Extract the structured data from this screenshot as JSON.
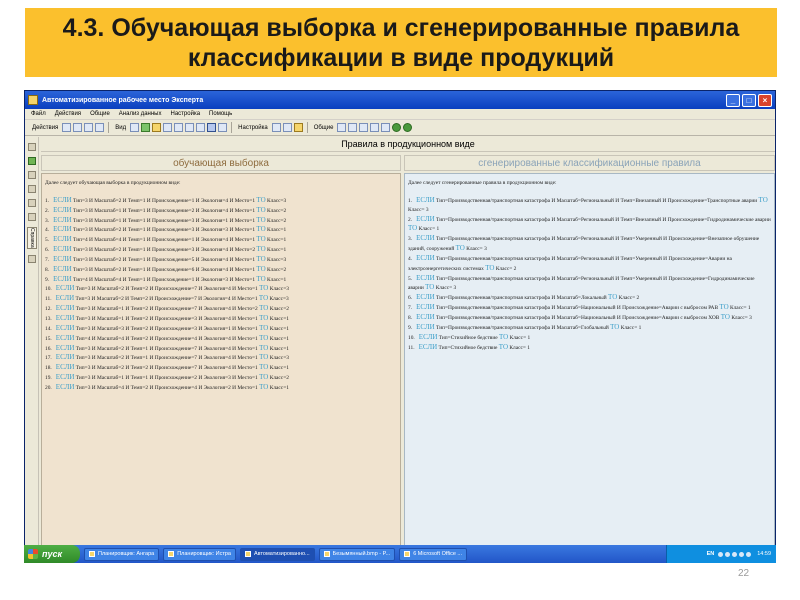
{
  "slide": {
    "title_line1": "4.3. Обучающая выборка и сгенерированные правила",
    "title_line2": "классификации в виде продукций",
    "page_number": "22"
  },
  "window": {
    "title": "Автоматизированное рабочее место Эксперта",
    "menu": [
      "Файл",
      "Действия",
      "Общие",
      "Анализ данных",
      "Настройка",
      "Помощь"
    ],
    "toolbar": {
      "actions_label": "Действия",
      "view_label": "Вид",
      "settings_label": "Настройка",
      "common_label": "Общие"
    },
    "left_tab_label": "Справка",
    "pane_header": "Правила в продукционном виде"
  },
  "left_panel": {
    "title": "обучающая выборка",
    "intro": "Далее следует обучающая выборка в продукционном виде:",
    "if": "ЕСЛИ",
    "then": "ТО",
    "rows": [
      {
        "n": "1.",
        "cond": "Тип=3 И Масштаб=2 И Темп=1 И Происхождение=1 И Экология=4 И Место=1",
        "cls": "Класс=3"
      },
      {
        "n": "2.",
        "cond": "Тип=3 И Масштаб=1 И Темп=1 И Происхождение=2 И Экология=4 И Место=1",
        "cls": "Класс=2"
      },
      {
        "n": "3.",
        "cond": "Тип=3 И Масштаб=1 И Темп=1 И Происхождение=3 И Экология=1 И Место=1",
        "cls": "Класс=2"
      },
      {
        "n": "4.",
        "cond": "Тип=3 И Масштаб=2 И Темп=1 И Происхождение=3 И Экология=3 И Место=1",
        "cls": "Класс=1"
      },
      {
        "n": "5.",
        "cond": "Тип=4 И Масштаб=4 И Темп=1 И Происхождение=1 И Экология=4 И Место=1",
        "cls": "Класс=1"
      },
      {
        "n": "6.",
        "cond": "Тип=3 И Масштаб=2 И Темп=1 И Происхождение=3 И Экология=4 И Место=2",
        "cls": "Класс=1"
      },
      {
        "n": "7.",
        "cond": "Тип=3 И Масштаб=2 И Темп=1 И Происхождение=5 И Экология=4 И Место=1",
        "cls": "Класс=3"
      },
      {
        "n": "8.",
        "cond": "Тип=3 И Масштаб=2 И Темп=1 И Происхождение=6 И Экология=4 И Место=1",
        "cls": "Класс=2"
      },
      {
        "n": "9.",
        "cond": "Тип=4 И Масштаб=4 И Темп=1 И Происхождение=1 И Экология=3 И Место=1",
        "cls": "Класс=1"
      },
      {
        "n": "10.",
        "cond": "Тип=3 И Масштаб=2 И Темп=2 И Происхождение=7 И Экология=4 И Место=1",
        "cls": "Класс=3"
      },
      {
        "n": "11.",
        "cond": "Тип=3 И Масштаб=2 И Темп=2 И Происхождение=7 И Экология=4 И Место=1",
        "cls": "Класс=3"
      },
      {
        "n": "12.",
        "cond": "Тип=3 И Масштаб=1 И Темп=2 И Происхождение=7 И Экология=4 И Место=2",
        "cls": "Класс=2"
      },
      {
        "n": "13.",
        "cond": "Тип=3 И Масштаб=1 И Темп=2 И Происхождение=3 И Экология=4 И Место=1",
        "cls": "Класс=1"
      },
      {
        "n": "14.",
        "cond": "Тип=3 И Масштаб=3 И Темп=2 И Происхождение=3 И Экология=1 И Место=1",
        "cls": "Класс=1"
      },
      {
        "n": "15.",
        "cond": "Тип=4 И Масштаб=4 И Темп=2 И Происхождение=4 И Экология=4 И Место=1",
        "cls": "Класс=1"
      },
      {
        "n": "16.",
        "cond": "Тип=3 И Масштаб=2 И Темп=1 И Происхождение=7 И Экология=4 И Место=1",
        "cls": "Класс=1"
      },
      {
        "n": "17.",
        "cond": "Тип=3 И Масштаб=2 И Темп=1 И Происхождение=7 И Экология=4 И Место=1",
        "cls": "Класс=3"
      },
      {
        "n": "18.",
        "cond": "Тип=3 И Масштаб=2 И Темп=2 И Происхождение=7 И Экология=4 И Место=1",
        "cls": "Класс=1"
      },
      {
        "n": "19.",
        "cond": "Тип=3 И Масштаб=1 И Темп=1 И Происхождение=2 И Экология=3 И Место=1",
        "cls": "Класс=2"
      },
      {
        "n": "20.",
        "cond": "Тип=3 И Масштаб=4 И Темп=2 И Происхождение=4 И Экология=2 И Место=1",
        "cls": "Класс=1"
      }
    ]
  },
  "right_panel": {
    "title": "сгенерированные классификационные правила",
    "intro": "Далее следует сгенерированные правила в продукционном виде:",
    "if": "ЕСЛИ",
    "then": "ТО",
    "rows": [
      {
        "n": "1.",
        "cond": "Тип=Производственная/транспортная катастрофа И Масштаб=Региональный И Темп=Внезапный И Происхождение=Транспортные аварии",
        "cls": "Класс= 3"
      },
      {
        "n": "2.",
        "cond": "Тип=Производственная/транспортная катастрофа И Масштаб=Региональный И Темп=Внезапный И Происхождение=Гидродинамические аварии",
        "cls": "Класс= 1"
      },
      {
        "n": "3.",
        "cond": "Тип=Производственная/транспортная катастрофа И Масштаб=Региональный И Темп=Умеренный И Происхождение=Внезапное обрушение зданий, сооружений",
        "cls": "Класс= 3"
      },
      {
        "n": "4.",
        "cond": "Тип=Производственная/транспортная катастрофа И Масштаб=Региональный И Темп=Умеренный И Происхождение=Аварии на электроэнергетических системах",
        "cls": "Класс= 2"
      },
      {
        "n": "5.",
        "cond": "Тип=Производственная/транспортная катастрофа И Масштаб=Региональный И Темп=Умеренный И Происхождение=Гидродинамические аварии",
        "cls": "Класс= 3"
      },
      {
        "n": "6.",
        "cond": "Тип=Производственная/транспортная катастрофа И Масштаб=Локальный",
        "cls": "Класс= 2"
      },
      {
        "n": "7.",
        "cond": "Тип=Производственная/транспортная катастрофа И Масштаб=Национальный И Происхождение=Аварии с выбросом РАВ",
        "cls": "Класс= 1"
      },
      {
        "n": "8.",
        "cond": "Тип=Производственная/транспортная катастрофа И Масштаб=Национальный И Происхождение=Аварии с выбросом ХОВ",
        "cls": "Класс= 3"
      },
      {
        "n": "9.",
        "cond": "Тип=Производственная/транспортная катастрофа И Масштаб=Глобальный",
        "cls": "Класс= 1"
      },
      {
        "n": "10.",
        "cond": "Тип=Стихийное бедствие",
        "cls": "Класс= 1"
      },
      {
        "n": "11.",
        "cond": "Тип=Стихийное бедствие",
        "cls": "Класс= 1"
      }
    ]
  },
  "taskbar": {
    "start": "пуск",
    "tasks": [
      "Планировщик: Ангара",
      "Планировщик: Истра",
      "Автоматизированно...",
      "Безымянный.bmp - P...",
      "6 Microsoft Office ..."
    ],
    "lang": "EN",
    "clock": "14:59"
  }
}
